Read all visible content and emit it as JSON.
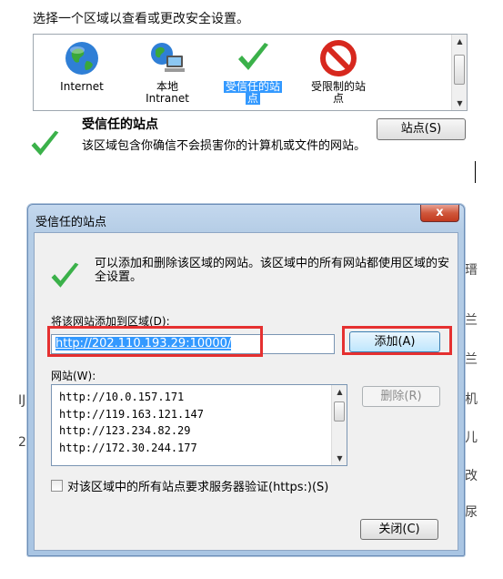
{
  "security_panel": {
    "instruction": "选择一个区域以查看或更改安全设置。",
    "zones": [
      {
        "label_line1": "Internet",
        "label_line2": "",
        "icon": "globe-icon",
        "selected": false
      },
      {
        "label_line1": "本地",
        "label_line2": "Intranet",
        "icon": "intranet-icon",
        "selected": false
      },
      {
        "label_line1": "受信任的站",
        "label_line2": "点",
        "icon": "checkmark-icon",
        "selected": true
      },
      {
        "label_line1": "受限制的站",
        "label_line2": "点",
        "icon": "restricted-icon",
        "selected": false
      }
    ],
    "selected_zone_title": "受信任的站点",
    "selected_zone_desc": "该区域包含你确信不会损害你的计算机或文件的网站。",
    "sites_button": "站点(S)"
  },
  "dialog": {
    "title": "受信任的站点",
    "close_symbol": "x",
    "description": "可以添加和删除该区域的网站。该区域中的所有网站都使用区域的安全设置。",
    "add_label": "将该网站添加到区域(D):",
    "url_value": "http://202.110.193.29:10000/",
    "add_button": "添加(A)",
    "sites_label": "网站(W):",
    "sites": [
      "http://10.0.157.171",
      "http://119.163.121.147",
      "http://123.234.82.29",
      "http://172.30.244.177"
    ],
    "remove_button": "删除(R)",
    "https_checkbox_label": "对该区域中的所有站点要求服务器验证(https:)(S)",
    "https_checked": false,
    "close_button": "关闭(C)"
  },
  "background_fragments": {
    "right_chars": [
      "瑨",
      "兰",
      "兰",
      "机",
      "儿",
      "改",
      "尿"
    ],
    "left_chars": [
      "IJ",
      "2"
    ]
  },
  "colors": {
    "selection": "#3399ff",
    "highlight_box": "#e53030",
    "dialog_frame": "#b5cde6"
  }
}
